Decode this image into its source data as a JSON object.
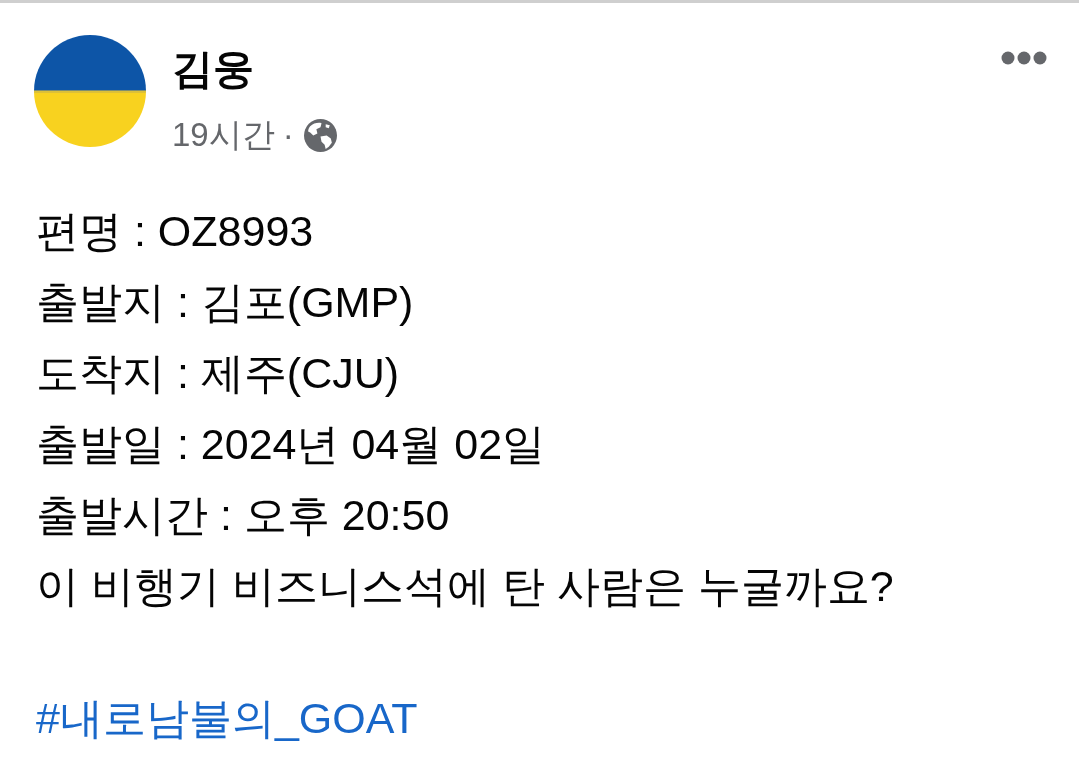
{
  "post": {
    "author": "김웅",
    "time": "19시간",
    "separator": "·",
    "lines": [
      "편명 : OZ8993",
      "출발지 : 김포(GMP)",
      "도착지 : 제주(CJU)",
      "출발일 : 2024년 04월 02일",
      "출발시간 : 오후 20:50",
      "이 비행기 비즈니스석에 탄 사람은 누굴까요?"
    ],
    "hashtag": "#내로남불의_GOAT"
  }
}
